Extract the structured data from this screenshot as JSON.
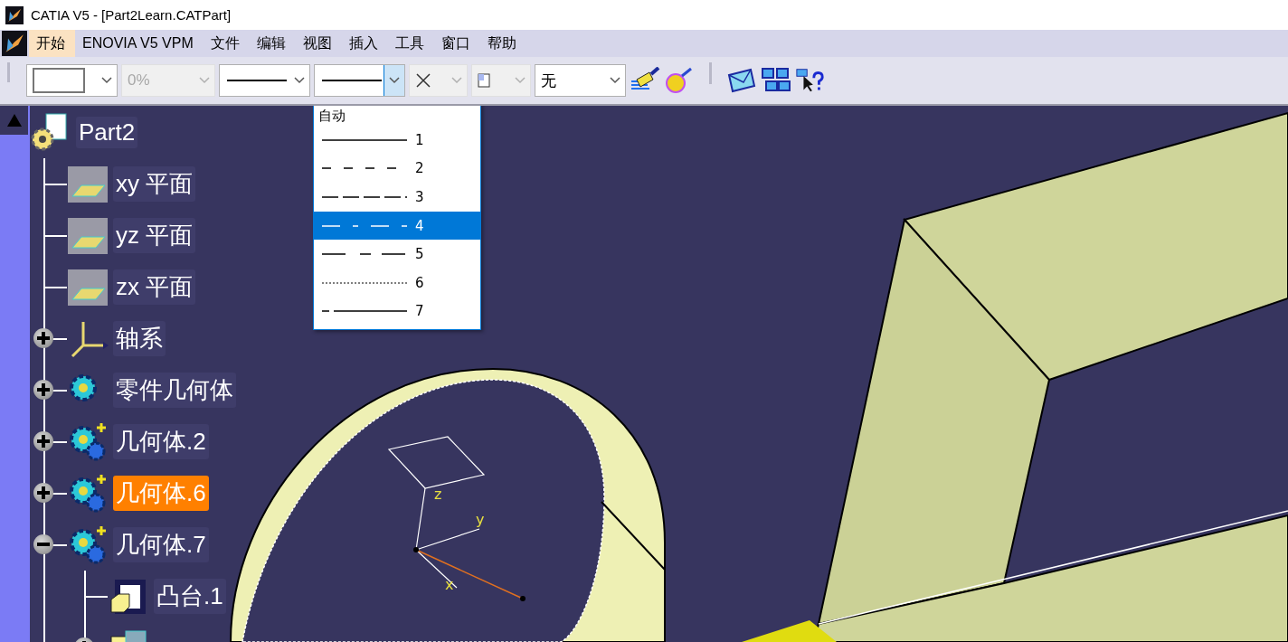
{
  "window": {
    "title": "CATIA V5 - [Part2Learn.CATPart]"
  },
  "menu": [
    {
      "label": "开始",
      "selected": true
    },
    {
      "label": "ENOVIA V5 VPM",
      "selected": false
    },
    {
      "label": "文件",
      "selected": false
    },
    {
      "label": "编辑",
      "selected": false
    },
    {
      "label": "视图",
      "selected": false
    },
    {
      "label": "插入",
      "selected": false
    },
    {
      "label": "工具",
      "selected": false
    },
    {
      "label": "窗口",
      "selected": false
    },
    {
      "label": "帮助",
      "selected": false
    }
  ],
  "toolbar": {
    "combos": [
      {
        "kind": "color",
        "disabled": false,
        "open": false
      },
      {
        "kind": "text",
        "value": "0%",
        "disabled": true,
        "open": false
      },
      {
        "kind": "line",
        "disabled": false,
        "open": false
      },
      {
        "kind": "line",
        "disabled": false,
        "open": true
      },
      {
        "kind": "point",
        "disabled": true,
        "open": false
      },
      {
        "kind": "layer",
        "disabled": true,
        "open": false
      },
      {
        "kind": "text",
        "value": "无",
        "disabled": false,
        "open": false
      }
    ]
  },
  "dropdown": {
    "header": "自动",
    "options": [
      {
        "label": "1",
        "selected": false
      },
      {
        "label": "2",
        "selected": false
      },
      {
        "label": "3",
        "selected": false
      },
      {
        "label": "4",
        "selected": true
      },
      {
        "label": "5",
        "selected": false
      },
      {
        "label": "6",
        "selected": false
      },
      {
        "label": "7",
        "selected": false
      }
    ]
  },
  "tree": {
    "label": "Part2",
    "kind": "part",
    "selected": false,
    "children": [
      {
        "label": "xy 平面",
        "kind": "plane",
        "selected": false
      },
      {
        "label": "yz 平面",
        "kind": "plane",
        "selected": false
      },
      {
        "label": "zx 平面",
        "kind": "plane",
        "selected": false
      },
      {
        "label": "轴系",
        "kind": "axis",
        "selected": false,
        "expanded": false
      },
      {
        "label": "零件几何体",
        "kind": "body",
        "selected": false,
        "expanded": false
      },
      {
        "label": "几何体.2",
        "kind": "bodyplus",
        "selected": false,
        "expanded": false
      },
      {
        "label": "几何体.6",
        "kind": "bodyplus",
        "selected": true,
        "expanded": false
      },
      {
        "label": "几何体.7",
        "kind": "bodyplus",
        "selected": false,
        "expanded": true,
        "children": [
          {
            "label": "凸台.1",
            "kind": "pad",
            "selected": false
          },
          {
            "kind": "thickness",
            "expanded": false
          }
        ]
      }
    ]
  },
  "viewport": {
    "axis_labels": [
      "z",
      "y",
      "x"
    ]
  }
}
